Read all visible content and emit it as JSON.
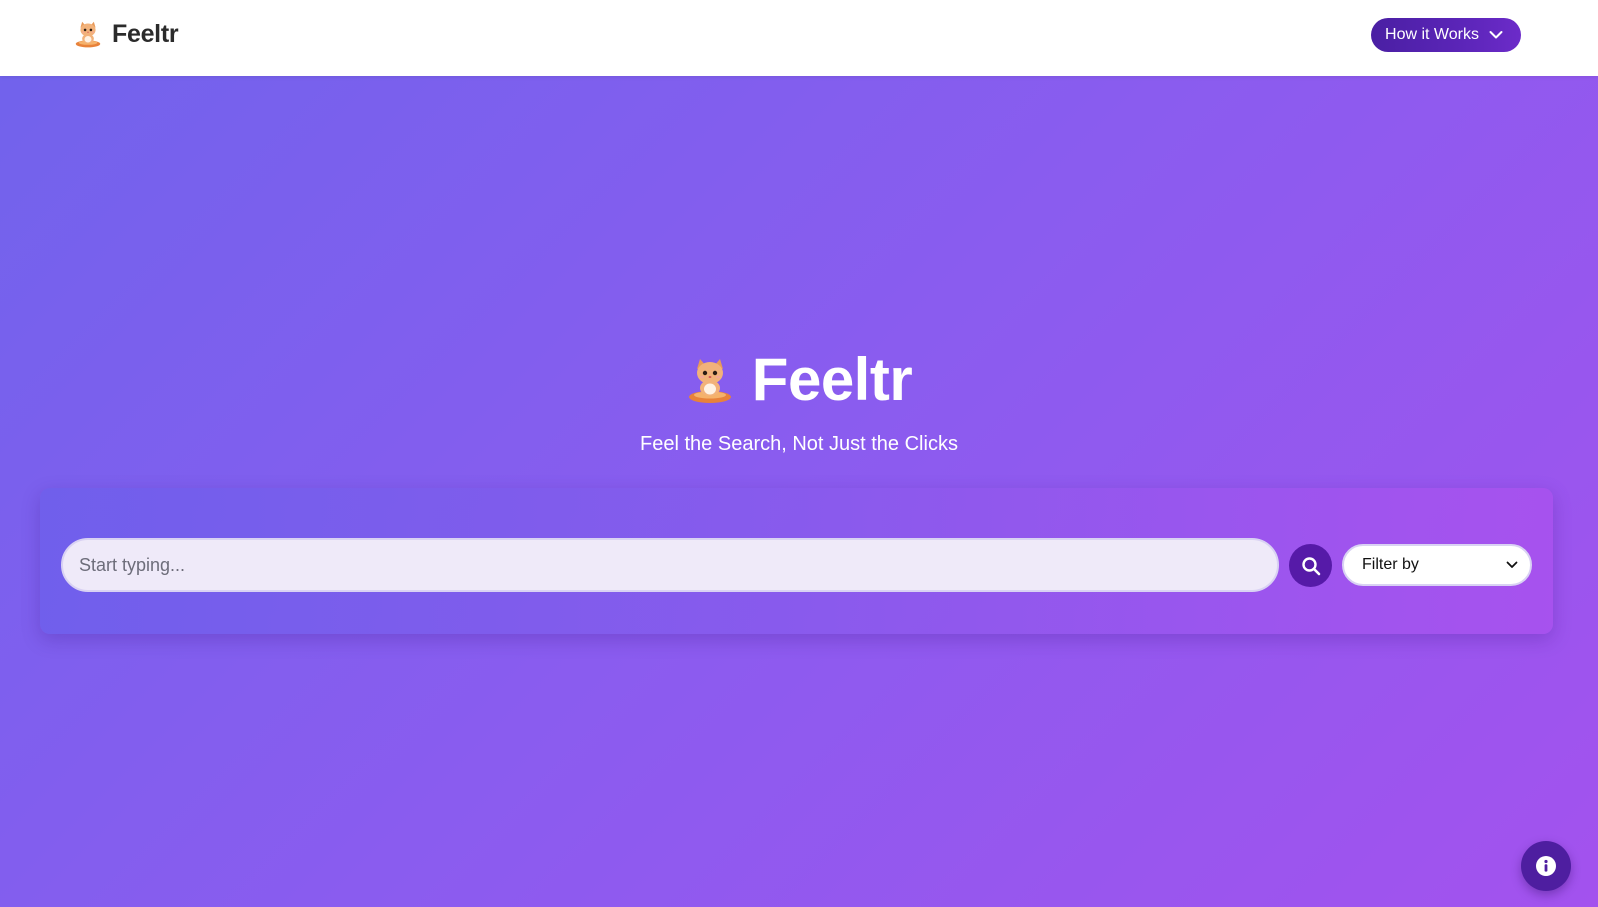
{
  "header": {
    "brand_name": "Feeltr",
    "how_it_works_label": "How it Works"
  },
  "hero": {
    "title": "Feeltr",
    "tagline": "Feel the Search, Not Just the Clicks"
  },
  "search": {
    "placeholder": "Start typing...",
    "value": "",
    "filter_selected": "Filter by"
  },
  "icons": {
    "brand_logo": "cat-in-bowl-icon",
    "how_chevron": "chevron-down-icon",
    "search": "search-icon",
    "filter_chevron": "chevron-down-icon",
    "info": "info-icon"
  },
  "colors": {
    "gradient_start": "#7063ec",
    "gradient_end": "#a352ee",
    "accent_dark": "#561aa8",
    "header_bg": "#ffffff"
  }
}
